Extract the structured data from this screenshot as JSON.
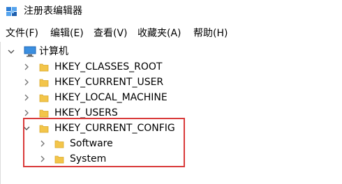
{
  "window": {
    "title": "注册表编辑器"
  },
  "menu": [
    {
      "label": "文件(F)"
    },
    {
      "label": "编辑(E)"
    },
    {
      "label": "查看(V)"
    },
    {
      "label": "收藏夹(A)"
    },
    {
      "label": "帮助(H)"
    }
  ],
  "tree": {
    "root": {
      "label": "计算机",
      "expanded": true
    },
    "items": [
      {
        "label": "HKEY_CLASSES_ROOT",
        "expanded": false
      },
      {
        "label": "HKEY_CURRENT_USER",
        "expanded": false
      },
      {
        "label": "HKEY_LOCAL_MACHINE",
        "expanded": false
      },
      {
        "label": "HKEY_USERS",
        "expanded": false
      },
      {
        "label": "HKEY_CURRENT_CONFIG",
        "expanded": true
      },
      {
        "label": "Software",
        "expanded": false
      },
      {
        "label": "System",
        "expanded": false
      }
    ]
  },
  "colors": {
    "highlight": "#d93a3a",
    "folder": "#f3c54a",
    "chevron": "#777777"
  },
  "icons": {
    "app": "registry-editor-icon",
    "root": "computer-icon",
    "folder": "folder-icon",
    "collapsed": "chevron-right-icon",
    "expanded": "chevron-down-icon"
  }
}
